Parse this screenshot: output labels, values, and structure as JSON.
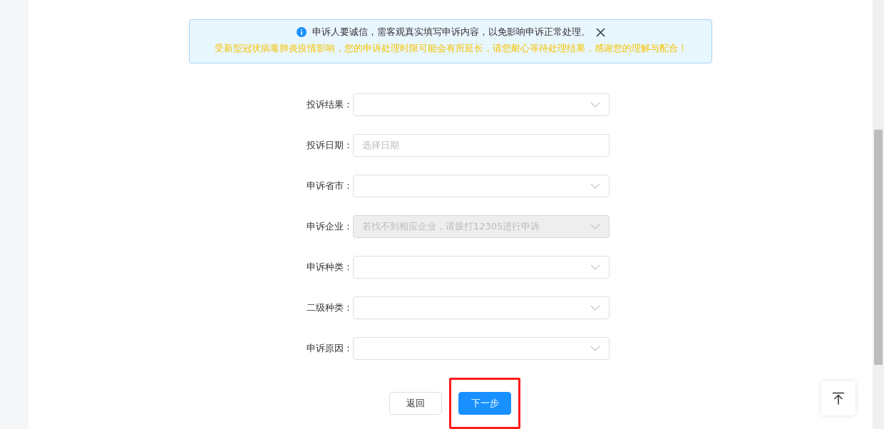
{
  "notice": {
    "message": "申诉人要诚信，需客观真实填写申诉内容，以免影响申诉正常处理。",
    "warning": "受新型冠状病毒肺炎疫情影响，您的申诉处理时限可能会有所延长，请您耐心等待处理结果，感谢您的理解与配合！"
  },
  "form": {
    "fields": [
      {
        "label": "投诉结果：",
        "kind": "select",
        "disabled": false
      },
      {
        "label": "投诉日期：",
        "kind": "date",
        "placeholder": "选择日期",
        "disabled": false
      },
      {
        "label": "申诉省市：",
        "kind": "select",
        "disabled": false
      },
      {
        "label": "申诉企业：",
        "kind": "select",
        "placeholder": "若找不到相应企业，请拨打12305进行申诉",
        "disabled": true
      },
      {
        "label": "申诉种类：",
        "kind": "select",
        "disabled": false
      },
      {
        "label": "二级种类：",
        "kind": "select",
        "disabled": false
      },
      {
        "label": "申诉原因：",
        "kind": "select",
        "disabled": false
      }
    ]
  },
  "buttons": [
    {
      "label": "返回",
      "kind": "default"
    },
    {
      "label": "下一步",
      "kind": "primary",
      "highlighted": true
    }
  ]
}
